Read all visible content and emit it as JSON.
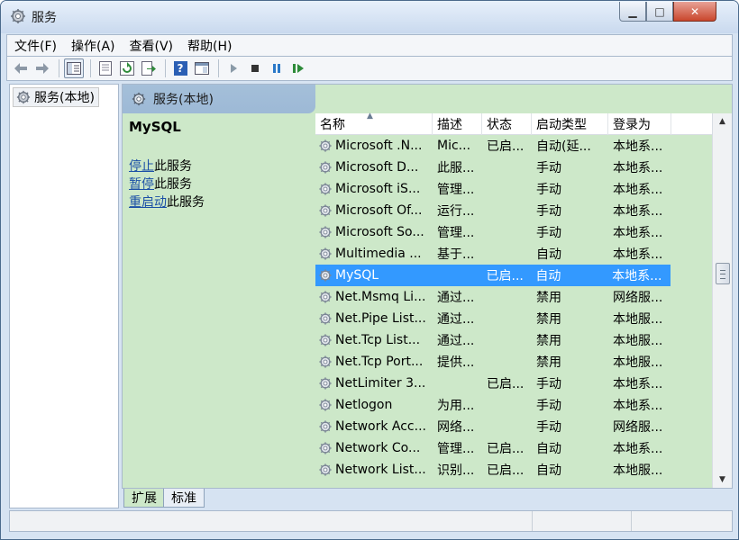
{
  "window": {
    "title": "服务",
    "minimize": "▁",
    "maximize": "□",
    "close": "✕"
  },
  "menubar": [
    "文件(F)",
    "操作(A)",
    "查看(V)",
    "帮助(H)"
  ],
  "toolbar": {
    "icons": [
      "back-arrow-icon",
      "forward-arrow-icon",
      "console-tree-icon",
      "properties-icon",
      "refresh-icon",
      "export-list-icon",
      "help-icon",
      "show-hide-icon",
      "start-service-icon",
      "stop-service-icon",
      "pause-service-icon",
      "restart-service-icon"
    ],
    "help_glyph": "?"
  },
  "tree": {
    "root": "服务(本地)"
  },
  "content": {
    "header": "服务(本地)",
    "selected_service": "MySQL",
    "actions": [
      {
        "link": "停止",
        "suffix": "此服务"
      },
      {
        "link": "暂停",
        "suffix": "此服务"
      },
      {
        "link": "重启动",
        "suffix": "此服务"
      }
    ]
  },
  "list": {
    "columns": [
      "名称",
      "描述",
      "状态",
      "启动类型",
      "登录为"
    ],
    "sort_indicator": "▲",
    "selected_index": 6,
    "rows": [
      {
        "name": "Microsoft .N...",
        "desc": "Mic...",
        "status": "已启...",
        "startup": "自动(延...",
        "logon": "本地系..."
      },
      {
        "name": "Microsoft D...",
        "desc": "此服...",
        "status": "",
        "startup": "手动",
        "logon": "本地系..."
      },
      {
        "name": "Microsoft iS...",
        "desc": "管理...",
        "status": "",
        "startup": "手动",
        "logon": "本地系..."
      },
      {
        "name": "Microsoft Of...",
        "desc": "运行...",
        "status": "",
        "startup": "手动",
        "logon": "本地系..."
      },
      {
        "name": "Microsoft So...",
        "desc": "管理...",
        "status": "",
        "startup": "手动",
        "logon": "本地系..."
      },
      {
        "name": "Multimedia ...",
        "desc": "基于...",
        "status": "",
        "startup": "自动",
        "logon": "本地系..."
      },
      {
        "name": "MySQL",
        "desc": "",
        "status": "已启...",
        "startup": "自动",
        "logon": "本地系..."
      },
      {
        "name": "Net.Msmq Li...",
        "desc": "通过...",
        "status": "",
        "startup": "禁用",
        "logon": "网络服..."
      },
      {
        "name": "Net.Pipe List...",
        "desc": "通过...",
        "status": "",
        "startup": "禁用",
        "logon": "本地服..."
      },
      {
        "name": "Net.Tcp List...",
        "desc": "通过...",
        "status": "",
        "startup": "禁用",
        "logon": "本地服..."
      },
      {
        "name": "Net.Tcp Port...",
        "desc": "提供...",
        "status": "",
        "startup": "禁用",
        "logon": "本地服..."
      },
      {
        "name": "NetLimiter 3...",
        "desc": "",
        "status": "已启...",
        "startup": "手动",
        "logon": "本地系..."
      },
      {
        "name": "Netlogon",
        "desc": "为用...",
        "status": "",
        "startup": "手动",
        "logon": "本地系..."
      },
      {
        "name": "Network Acc...",
        "desc": "网络...",
        "status": "",
        "startup": "手动",
        "logon": "网络服..."
      },
      {
        "name": "Network Co...",
        "desc": "管理...",
        "status": "已启...",
        "startup": "自动",
        "logon": "本地系..."
      },
      {
        "name": "Network List...",
        "desc": "识别...",
        "status": "已启...",
        "startup": "自动",
        "logon": "本地服..."
      }
    ]
  },
  "scrollbar": {
    "up": "▲",
    "down": "▼"
  },
  "tabs": [
    "扩展",
    "标准"
  ],
  "active_tab": "扩展",
  "colors": {
    "selection": "#3399ff",
    "content_bg": "#cde8c9",
    "link": "#1a4fa6"
  }
}
